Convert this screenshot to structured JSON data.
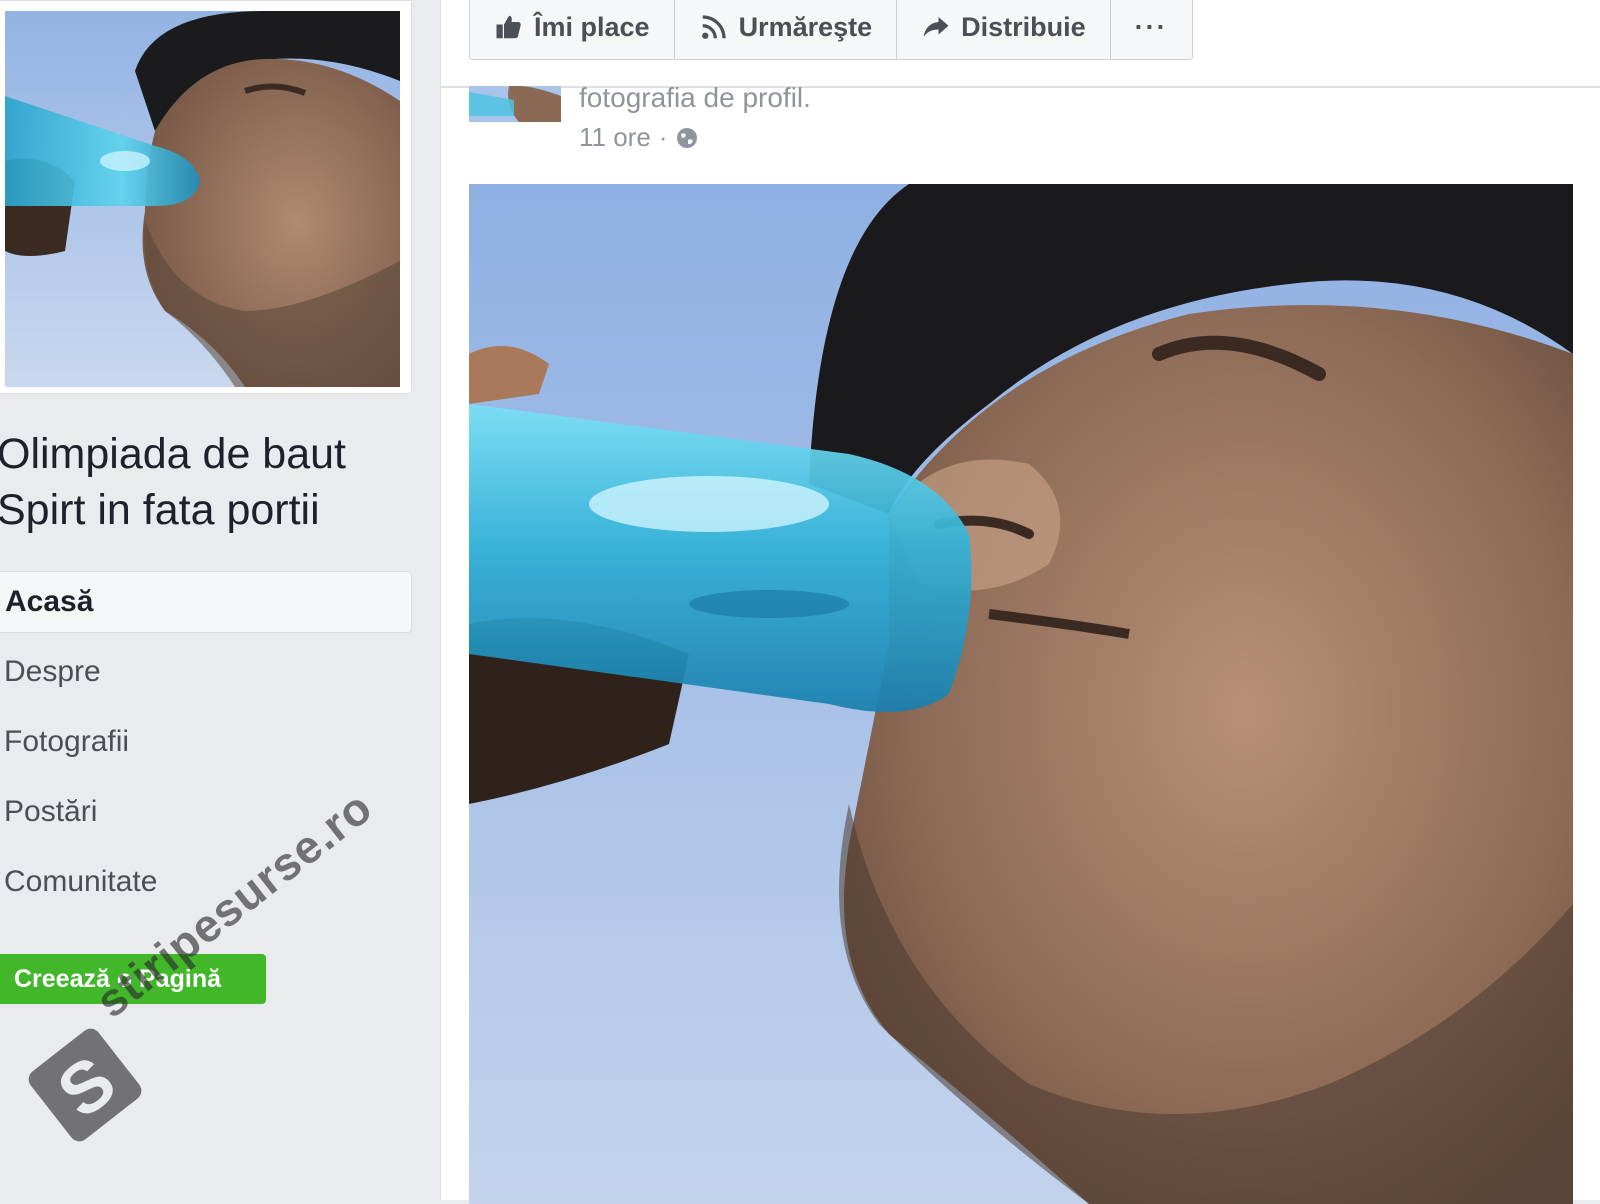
{
  "sidebar": {
    "page_name": "Olimpiada de baut Spirt in fata portii",
    "nav_items": [
      {
        "label": "Acasă",
        "active": true
      },
      {
        "label": "Despre",
        "active": false
      },
      {
        "label": "Fotografii",
        "active": false
      },
      {
        "label": "Postări",
        "active": false
      },
      {
        "label": "Comunitate",
        "active": false
      }
    ],
    "create_page_label": "Creează o Pagină"
  },
  "actions": {
    "like_label": "Îmi place",
    "follow_label": "Urmăreşte",
    "share_label": "Distribuie",
    "more_label": "···"
  },
  "post": {
    "caption": "fotografia de profil.",
    "time": "11 ore",
    "separator": "·",
    "privacy_icon": "globe-icon"
  },
  "watermark": {
    "text": "stiripesurse.ro",
    "logo_letter": "S"
  },
  "colors": {
    "background": "#e9ebee",
    "create_button": "#42b72a",
    "sky": "#a9c4ea",
    "bottle": "#3fb7d9"
  }
}
